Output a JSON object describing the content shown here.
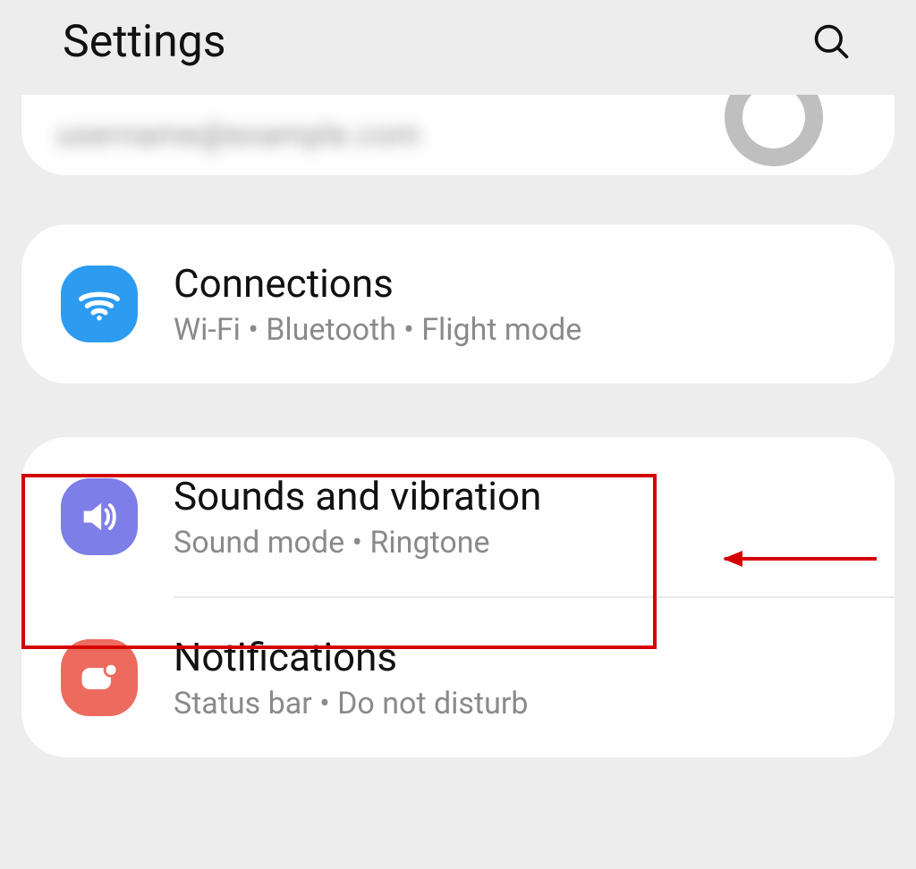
{
  "header": {
    "title": "Settings"
  },
  "account": {
    "blurred": "username@example.com"
  },
  "items": {
    "connections": {
      "title": "Connections",
      "sub": "Wi-Fi  •  Bluetooth  •  Flight mode"
    },
    "sounds": {
      "title": "Sounds and vibration",
      "sub": "Sound mode  •  Ringtone"
    },
    "notifications": {
      "title": "Notifications",
      "sub": "Status bar  •  Do not disturb"
    }
  },
  "annotation": {
    "highlighted_item": "sounds"
  }
}
